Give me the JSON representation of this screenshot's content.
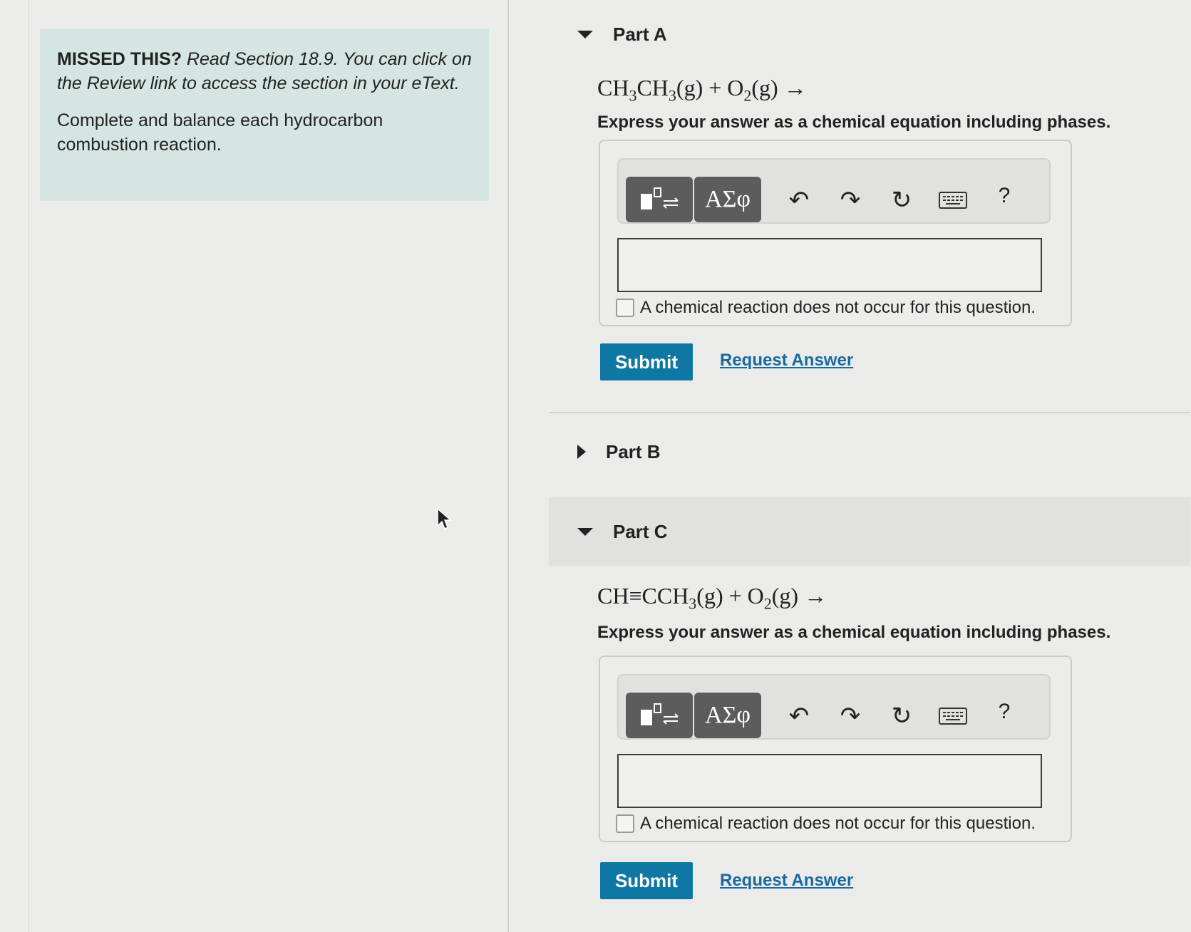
{
  "hint": {
    "missed_label": "MISSED THIS?",
    "missed_text": "Read Section 18.9. You can click on the Review link to access the section in your eText.",
    "instruction": "Complete and balance each hydrocarbon combustion reaction."
  },
  "parts": {
    "a": {
      "title": "Part A",
      "eq_r1": "CH",
      "eq_r1_sub": "3",
      "eq_r2": "CH",
      "eq_r2_sub": "3",
      "eq_r2_phase": "(g) + O",
      "eq_o2_sub": "2",
      "eq_tail": "(g) →",
      "instruction": "Express your answer as a chemical equation including phases.",
      "no_reaction_label": "A chemical reaction does not occur for this question.",
      "submit_label": "Submit",
      "request_label": "Request Answer"
    },
    "b": {
      "title": "Part B"
    },
    "c": {
      "title": "Part C",
      "eq_r1": "CH≡CCH",
      "eq_r1_sub": "3",
      "eq_r1_phase": "(g) + O",
      "eq_o2_sub": "2",
      "eq_tail": "(g) →",
      "instruction": "Express your answer as a chemical equation including phases.",
      "no_reaction_label": "A chemical reaction does not occur for this question.",
      "submit_label": "Submit",
      "request_label": "Request Answer"
    }
  },
  "toolbar": {
    "greek_label": "ΑΣφ",
    "undo_glyph": "↶",
    "redo_glyph": "↷",
    "reset_glyph": "↻",
    "help_label": "?",
    "icons": [
      "templates-icon",
      "greek-letters",
      "undo-icon",
      "redo-icon",
      "reset-icon",
      "keyboard-icon",
      "help-icon"
    ]
  },
  "colors": {
    "submit_bg": "#0f77a4",
    "link": "#1a6aa0",
    "hint_bg": "#d5e5e1",
    "tool_btn": "#5c5c5c"
  }
}
